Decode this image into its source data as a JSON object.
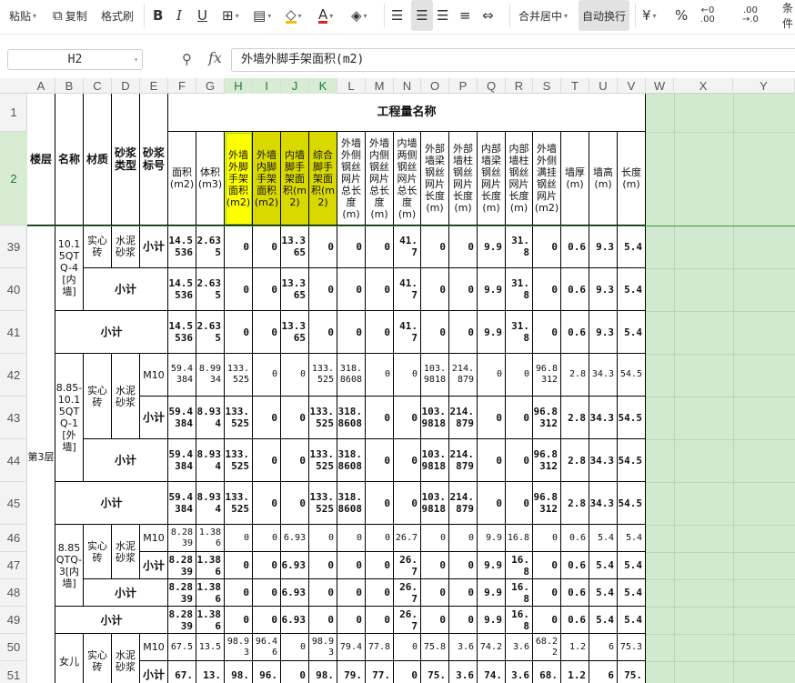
{
  "toolbar": {
    "paste": "粘贴",
    "copy": "复制",
    "format_painter": "格式刷",
    "merge_center": "合并居中",
    "wrap_text": "自动换行",
    "condition": "条件"
  },
  "formula_bar": {
    "cell_ref": "H2",
    "formula": "外墙外脚手架面积(m2)"
  },
  "columns": [
    "A",
    "B",
    "C",
    "D",
    "E",
    "F",
    "G",
    "H",
    "I",
    "J",
    "K",
    "L",
    "M",
    "N",
    "O",
    "P",
    "Q",
    "R",
    "S",
    "T",
    "U",
    "V",
    "W",
    "X",
    "Y"
  ],
  "rows": [
    "1",
    "2",
    "39",
    "40",
    "41",
    "42",
    "43",
    "44",
    "45",
    "46",
    "47",
    "48",
    "49",
    "50",
    "51"
  ],
  "sheet": {
    "section_title": "工程量名称",
    "h_floor": "楼层",
    "h_name": "名称",
    "h_material": "材质",
    "h_mortar_type": "砂浆类型",
    "h_mortar_grade": "砂浆标号",
    "h_cols": [
      "面积(m2)",
      "体积(m3)",
      "外墙外脚手架面积(m2)",
      "外墙内脚手架面积(m2)",
      "内墙脚手架面积(m2)",
      "综合脚手架面积(m2)",
      "外墙外侧钢丝网片总长度(m)",
      "外墙内侧钢丝网片总长度(m)",
      "内墙两侧钢丝网片总长度(m)",
      "外部墙梁钢丝网片长度(m)",
      "外部墙柱钢丝网片长度(m)",
      "内部墙梁钢丝网片长度(m)",
      "内部墙柱钢丝网片长度(m)",
      "外墙外侧满挂钢丝网片(m2)",
      "墙厚(m)",
      "墙高(m)",
      "长度(m)"
    ],
    "floor": "第3层",
    "groups": [
      {
        "name": "10.15QTQ-4[内墙]",
        "material": "实心砖",
        "mortar": "水泥砂浆"
      },
      {
        "name": "8.85-10.15QTQ-1[外墙]",
        "material": "实心砖",
        "mortar": "水泥砂浆"
      },
      {
        "name": "8.85QTQ-3[内墙]",
        "material": "实心砖",
        "mortar": "水泥砂浆"
      },
      {
        "name": "女儿",
        "material": "实心砖",
        "mortar": "水泥砂浆"
      }
    ],
    "subtotal": "小计",
    "grade": "M10",
    "r39": [
      "14.5536",
      "2.635",
      "0",
      "0",
      "13.365",
      "0",
      "0",
      "0",
      "41.7",
      "0",
      "0",
      "9.9",
      "31.8",
      "0",
      "0.6",
      "9.3",
      "5.4"
    ],
    "r40": [
      "14.5536",
      "2.635",
      "0",
      "0",
      "13.365",
      "0",
      "0",
      "0",
      "41.7",
      "0",
      "0",
      "9.9",
      "31.8",
      "0",
      "0.6",
      "9.3",
      "5.4"
    ],
    "r41": [
      "14.5536",
      "2.635",
      "0",
      "0",
      "13.365",
      "0",
      "0",
      "0",
      "41.7",
      "0",
      "0",
      "9.9",
      "31.8",
      "0",
      "0.6",
      "9.3",
      "5.4"
    ],
    "r42": [
      "59.4384",
      "8.9934",
      "133.525",
      "0",
      "0",
      "133.525",
      "318.8608",
      "0",
      "0",
      "103.9818",
      "214.879",
      "0",
      "0",
      "96.8312",
      "2.8",
      "34.3",
      "54.5"
    ],
    "r43": [
      "59.4384",
      "8.934",
      "133.525",
      "0",
      "0",
      "133.525",
      "318.8608",
      "0",
      "0",
      "103.9818",
      "214.879",
      "0",
      "0",
      "96.8312",
      "2.8",
      "34.3",
      "54.5"
    ],
    "r44": [
      "59.4384",
      "8.934",
      "133.525",
      "0",
      "0",
      "133.525",
      "318.8608",
      "0",
      "0",
      "103.9818",
      "214.879",
      "0",
      "0",
      "96.8312",
      "2.8",
      "34.3",
      "54.5"
    ],
    "r45": [
      "59.4384",
      "8.934",
      "133.525",
      "0",
      "0",
      "133.525",
      "318.8608",
      "0",
      "0",
      "103.9818",
      "214.879",
      "0",
      "0",
      "96.8312",
      "2.8",
      "34.3",
      "54.5"
    ],
    "r46": [
      "8.2839",
      "1.386",
      "0",
      "0",
      "6.93",
      "0",
      "0",
      "0",
      "26.7",
      "0",
      "0",
      "9.9",
      "16.8",
      "0",
      "0.6",
      "5.4",
      "5.4"
    ],
    "r47": [
      "8.2839",
      "1.386",
      "0",
      "0",
      "6.93",
      "0",
      "0",
      "0",
      "26.7",
      "0",
      "0",
      "9.9",
      "16.8",
      "0",
      "0.6",
      "5.4",
      "5.4"
    ],
    "r48": [
      "8.2839",
      "1.386",
      "0",
      "0",
      "6.93",
      "0",
      "0",
      "0",
      "26.7",
      "0",
      "0",
      "9.9",
      "16.8",
      "0",
      "0.6",
      "5.4",
      "5.4"
    ],
    "r49": [
      "8.2839",
      "1.386",
      "0",
      "0",
      "6.93",
      "0",
      "0",
      "0",
      "26.7",
      "0",
      "0",
      "9.9",
      "16.8",
      "0",
      "0.6",
      "5.4",
      "5.4"
    ],
    "r50": [
      "67.5",
      "13.5",
      "98.93",
      "96.46",
      "0",
      "98.93",
      "79.4",
      "77.8",
      "0",
      "75.8",
      "3.6",
      "74.2",
      "3.6",
      "68.22",
      "1.2",
      "6",
      "75.3"
    ],
    "r51": [
      "67.",
      "13.",
      "98.",
      "96.",
      "0",
      "98.",
      "79.",
      "77.",
      "0",
      "75.",
      "3.6",
      "74.",
      "3.6",
      "68.",
      "1.2",
      "6",
      "75."
    ]
  }
}
